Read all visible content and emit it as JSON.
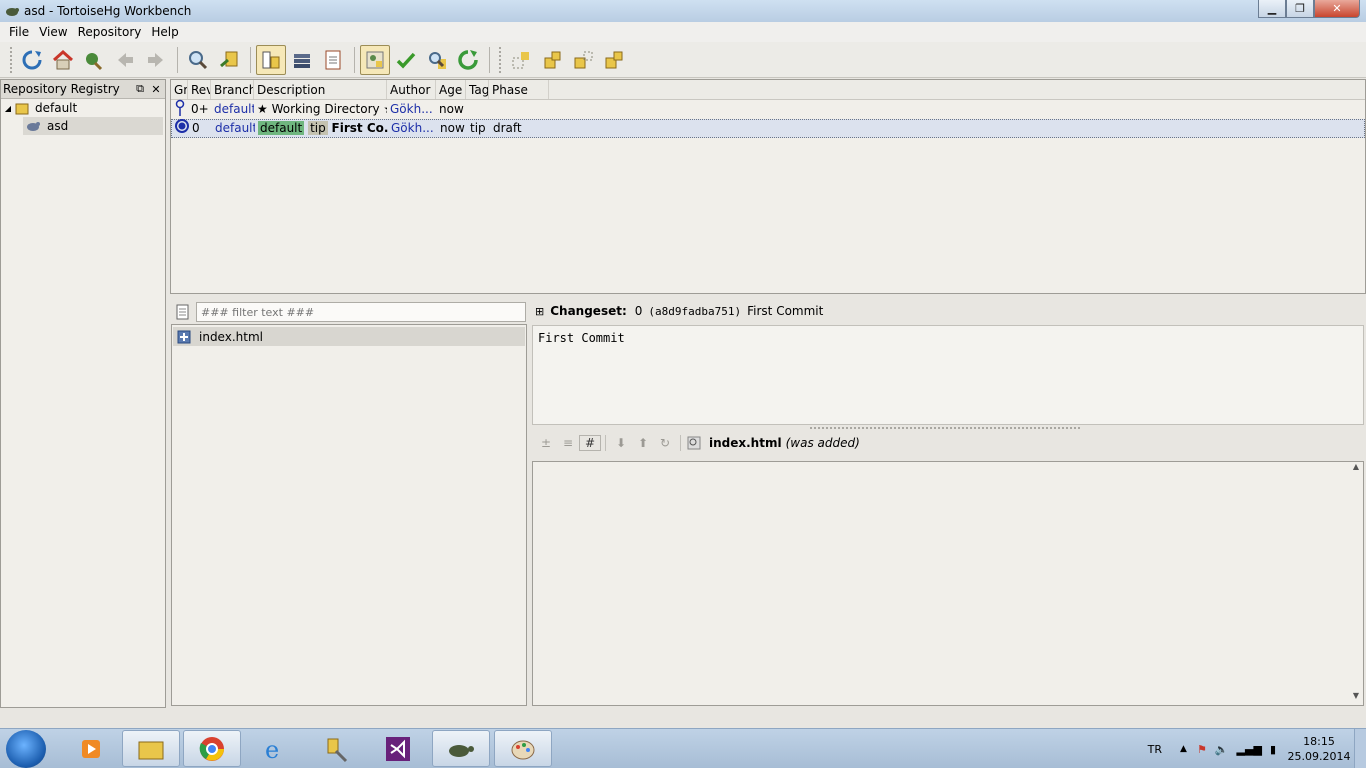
{
  "window": {
    "title": "asd - TortoiseHg Workbench",
    "minimize": "▁",
    "maximize": "❐",
    "close": "✕"
  },
  "menu": [
    "File",
    "View",
    "Repository",
    "Help"
  ],
  "toolbar_icons": [
    "refresh-icon",
    "home-icon",
    "update-icon",
    "back-icon",
    "forward-icon",
    "search-icon",
    "goto-icon",
    "revision-details-icon",
    "commit-stack-icon",
    "log-icon",
    "commit-icon",
    "check-icon",
    "search-changes-icon",
    "sync-icon",
    "incoming-icon",
    "pull-icon",
    "outgoing-icon",
    "push-icon"
  ],
  "registry": {
    "title": "Repository Registry",
    "float_btn": "⧉",
    "close_btn": "✕",
    "group": "default",
    "repo": "asd"
  },
  "revisions": {
    "headers": [
      "Gr",
      "Rev",
      "Branch",
      "Description",
      "Author",
      "Age",
      "Tags",
      "Phase"
    ],
    "rows": [
      {
        "rev": "0+",
        "branch": "default",
        "desc": "★ Working Directory ★",
        "author": "Gökh...",
        "age": "now",
        "tags": "",
        "phase": ""
      },
      {
        "rev": "0",
        "branch": "default",
        "branch_tag": "default",
        "tip_tag": "tip",
        "desc": "First Co...",
        "author": "Gökh...",
        "age": "now",
        "tags": "tip",
        "phase": "draft"
      }
    ]
  },
  "file_filter": {
    "placeholder": "### filter text ###"
  },
  "files": [
    "index.html"
  ],
  "changeset": {
    "label": "Changeset:",
    "rev": "0",
    "hash": "(a8d9fadba751)",
    "summary": "First Commit",
    "message": "First Commit"
  },
  "diff": {
    "filename": "index.html",
    "status": "(was added)",
    "buttons": [
      "±",
      "≡",
      "#",
      "⬇",
      "⬆",
      "↻"
    ]
  },
  "taskbar": {
    "language": "TR",
    "time": "18:15",
    "date": "25.09.2014"
  }
}
